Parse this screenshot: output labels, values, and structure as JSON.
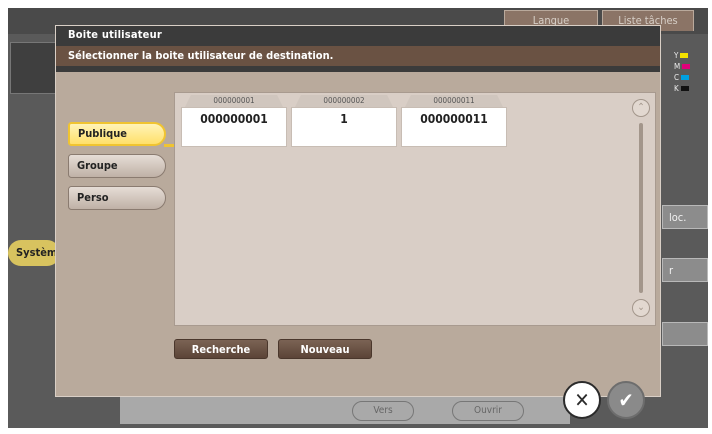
{
  "background": {
    "tabs": [
      "Langue",
      "Liste tâches"
    ],
    "left_label": "Systèm",
    "right_buttons": [
      "loc.",
      "r",
      ""
    ],
    "cmyk": [
      "Y",
      "M",
      "C",
      "K"
    ],
    "bottom_buttons": [
      "Vers",
      "Ouvrir"
    ]
  },
  "modal": {
    "title": "Boite utilisateur",
    "subtitle": "Sélectionner la boite utilisateur de destination.",
    "categories": [
      {
        "label": "Publique",
        "active": true
      },
      {
        "label": "Groupe",
        "active": false
      },
      {
        "label": "Perso",
        "active": false
      }
    ],
    "boxes": [
      {
        "number": "000000001",
        "name": "000000001"
      },
      {
        "number": "000000002",
        "name": "1"
      },
      {
        "number": "000000011",
        "name": "000000011"
      }
    ],
    "actions": {
      "search": "Recherche",
      "new": "Nouveau"
    },
    "scroll": {
      "up": "⌃",
      "down": "⌄"
    },
    "close_symbol": "✕",
    "ok_symbol": "✔"
  }
}
